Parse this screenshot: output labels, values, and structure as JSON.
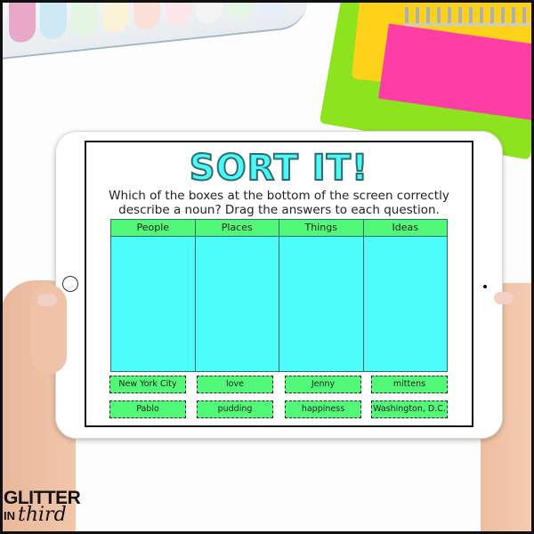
{
  "activity": {
    "title": "SORT IT!",
    "instructions_line1": "Which of the boxes at the bottom of the screen correctly",
    "instructions_line2": "describe a noun? Drag the answers to each question.",
    "categories": [
      {
        "label": "People"
      },
      {
        "label": "Places"
      },
      {
        "label": "Things"
      },
      {
        "label": "Ideas"
      }
    ],
    "cards": [
      {
        "label": "New York City"
      },
      {
        "label": "love"
      },
      {
        "label": "Jenny"
      },
      {
        "label": "mittens"
      },
      {
        "label": "Pablo"
      },
      {
        "label": "pudding"
      },
      {
        "label": "happiness"
      },
      {
        "label": "Washington, D.C."
      }
    ]
  },
  "branding": {
    "line1": "GLITTER",
    "line2_prefix": "IN",
    "line2_script": "third"
  },
  "colors": {
    "title_fill": "#4ef6f4",
    "header_green": "#52f978",
    "drop_cyan": "#4dfdfb",
    "card_green": "#52f978"
  }
}
